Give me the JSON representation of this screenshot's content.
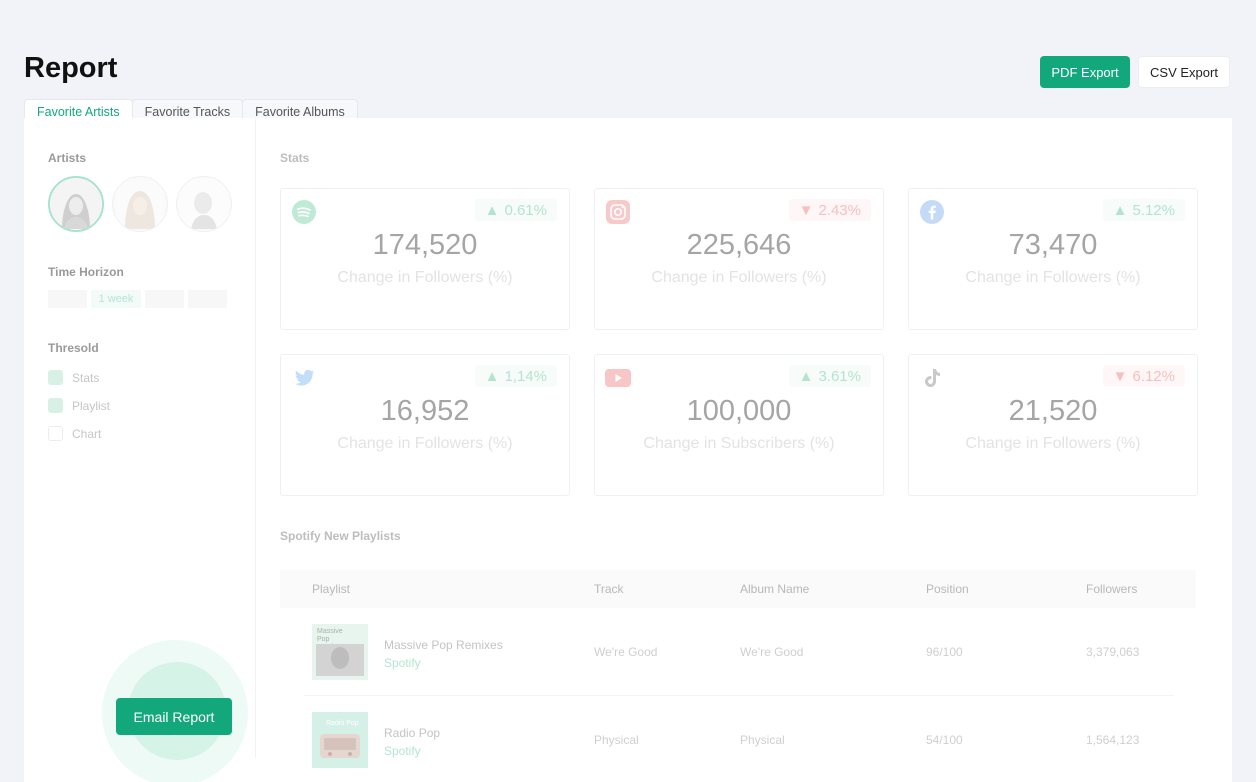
{
  "page": {
    "title": "Report"
  },
  "actions": {
    "pdf": "PDF Export",
    "csv": "CSV Export",
    "email": "Email Report"
  },
  "tabs": [
    {
      "label": "Favorite Artists",
      "active": true
    },
    {
      "label": "Favorite Tracks",
      "active": false
    },
    {
      "label": "Favorite Albums",
      "active": false
    }
  ],
  "sidebar": {
    "artists_label": "Artists",
    "time_horizon_label": "Time Horizon",
    "time_horizon_selected": "1 week",
    "threshold_label": "Thresold",
    "checks": [
      {
        "label": "Stats",
        "checked": true
      },
      {
        "label": "Playlist",
        "checked": true
      },
      {
        "label": "Chart",
        "checked": false
      }
    ]
  },
  "stats": {
    "label": "Stats",
    "cards": [
      {
        "platform": "spotify-icon",
        "change": "0.61%",
        "dir": "up",
        "value": "174,520",
        "caption": "Change in Followers (%)"
      },
      {
        "platform": "instagram-icon",
        "change": "2.43%",
        "dir": "down",
        "value": "225,646",
        "caption": "Change in Followers (%)"
      },
      {
        "platform": "facebook-icon",
        "change": "5.12%",
        "dir": "up",
        "value": "73,470",
        "caption": "Change in Followers (%)"
      },
      {
        "platform": "twitter-icon",
        "change": "1,14%",
        "dir": "up",
        "value": "16,952",
        "caption": "Change in Followers (%)"
      },
      {
        "platform": "youtube-icon",
        "change": "3.61%",
        "dir": "up",
        "value": "100,000",
        "caption": "Change in Subscribers (%)"
      },
      {
        "platform": "tiktok-icon",
        "change": "6.12%",
        "dir": "down",
        "value": "21,520",
        "caption": "Change in Followers (%)"
      }
    ]
  },
  "playlists": {
    "label": "Spotify New Playlists",
    "columns": [
      "Playlist",
      "Track",
      "Album Name",
      "Position",
      "Followers"
    ],
    "rows": [
      {
        "name": "Massive Pop Remixes",
        "source": "Spotify",
        "thumb_text": "Massive Pop Remixes",
        "track": "We're Good",
        "album": "We're Good",
        "position": "96/100",
        "followers": "3,379,063"
      },
      {
        "name": "Radio Pop",
        "source": "Spotify",
        "thumb_text": "Radio Pop",
        "track": "Physical",
        "album": "Physical",
        "position": "54/100",
        "followers": "1,564,123"
      }
    ]
  }
}
